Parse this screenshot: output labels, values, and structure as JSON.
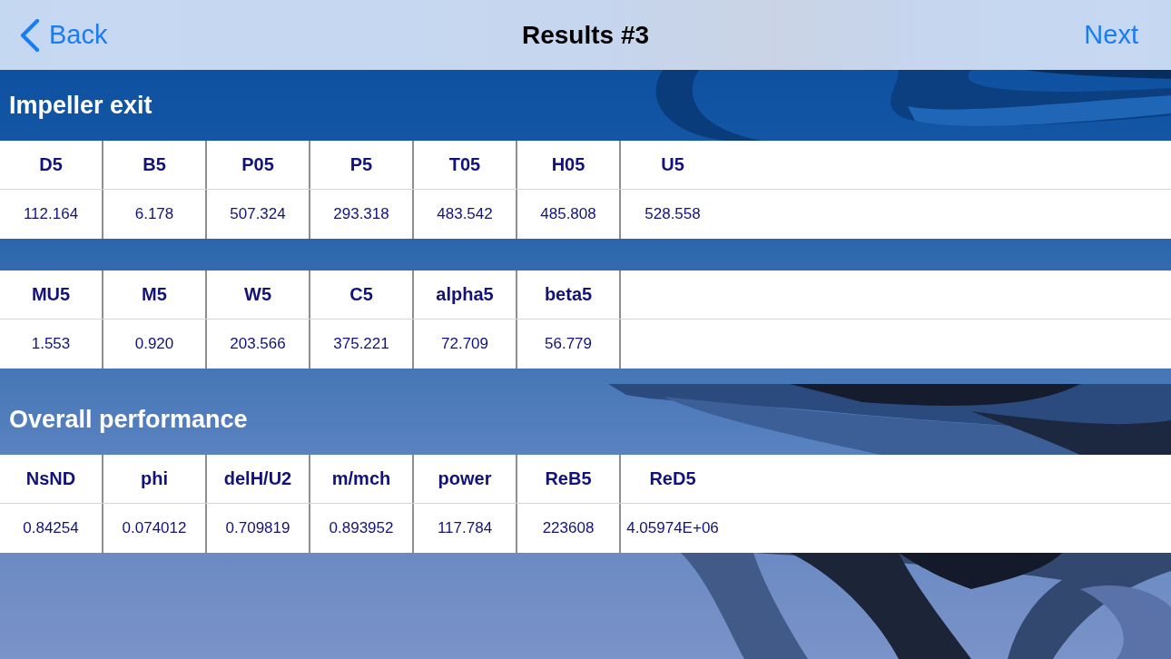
{
  "nav_bar": {
    "back": "Back",
    "title": "Results #3",
    "next": "Next"
  },
  "sections": [
    {
      "title": "Impeller exit",
      "tables": [
        {
          "columns": [
            "D5",
            "B5",
            "P05",
            "P5",
            "T05",
            "H05",
            "U5"
          ],
          "values": [
            "112.164",
            "6.178",
            "507.324",
            "293.318",
            "483.542",
            "485.808",
            "528.558"
          ]
        },
        {
          "columns": [
            "MU5",
            "M5",
            "W5",
            "C5",
            "alpha5",
            "beta5"
          ],
          "values": [
            "1.553",
            "0.920",
            "203.566",
            "375.221",
            "72.709",
            "56.779"
          ]
        }
      ]
    },
    {
      "title": "Overall performance",
      "tables": [
        {
          "columns": [
            "NsND",
            "phi",
            "delH/U2",
            "m/mch",
            "power",
            "ReB5",
            "ReD5"
          ],
          "values": [
            "0.84254",
            "0.074012",
            "0.709819",
            "0.893952",
            "117.784",
            "223608",
            "4.05974E+06"
          ]
        }
      ]
    }
  ]
}
